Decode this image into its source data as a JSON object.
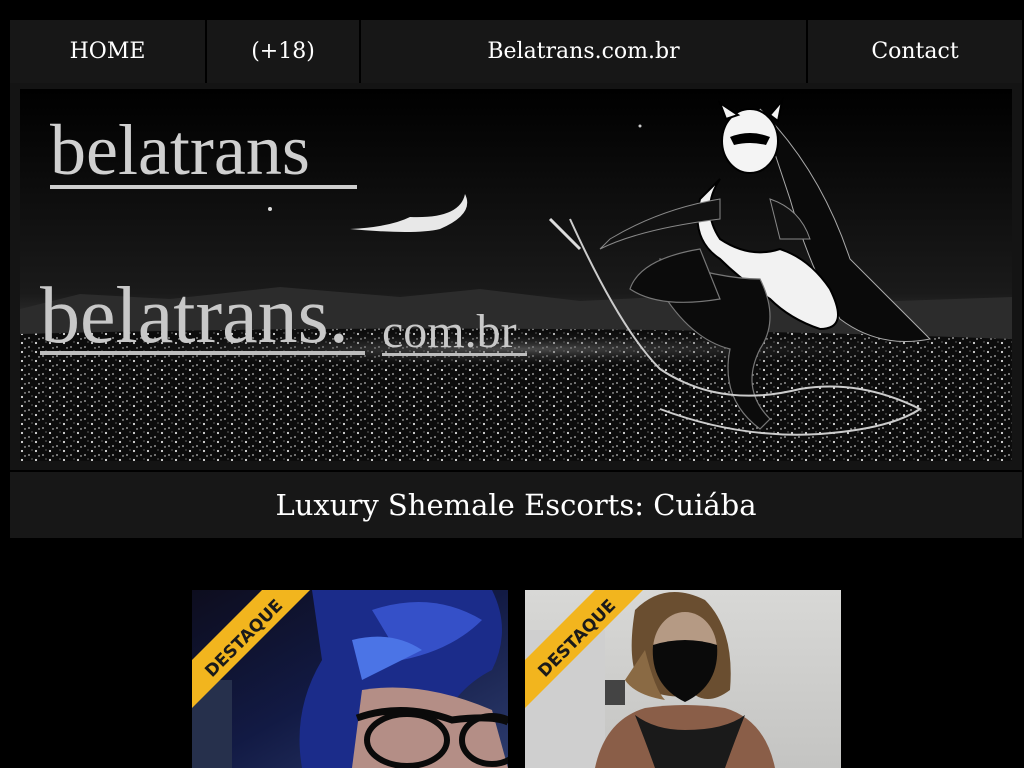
{
  "nav": {
    "home": "HOME",
    "adult": "(+18)",
    "site": "Belatrans.com.br",
    "contact": "Contact"
  },
  "banner": {
    "logo_top": "belatrans",
    "logo_main": "belatrans.",
    "logo_suffix": "com.br"
  },
  "page_title": "Luxury Shemale Escorts: Cuiába",
  "cards": [
    {
      "badge": "DESTAQUE"
    },
    {
      "badge": "DESTAQUE"
    }
  ],
  "colors": {
    "background": "#000000",
    "bar": "#171717",
    "badge": "#f2b51e"
  }
}
